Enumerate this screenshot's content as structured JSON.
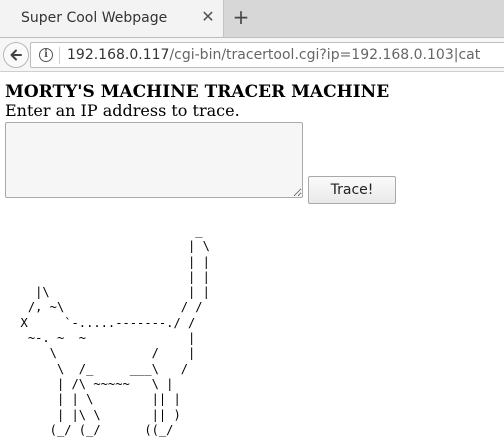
{
  "browser": {
    "tab_title": "Super Cool Webpage",
    "tab_close_glyph": "✕",
    "new_tab_glyph": "+",
    "url_host": "192.168.0.117",
    "url_path": "/cgi-bin/tracertool.cgi?ip=192.168.0.103|cat",
    "icons": [
      "back-arrow-icon",
      "info-icon",
      "close-icon",
      "plus-icon"
    ]
  },
  "page": {
    "title": "MORTY'S MACHINE TRACER MACHINE",
    "instructions": "Enter an IP address to trace.",
    "ip_input_value": "",
    "trace_button_label": "Trace!",
    "ascii_art": "                          _\n                         | \\\n                         | |\n                         | |\n    |\\                   | |\n   /, ~\\                / /\n  X     `-.....-------./ /\n   ~-. ~  ~              |\n      \\             /    |\n       \\  /_     ___\\   /\n       | /\\ ~~~~~   \\ |\n       | | \\        || |\n       | |\\ \\       || )\n      (_/ (_/      ((_/"
  }
}
